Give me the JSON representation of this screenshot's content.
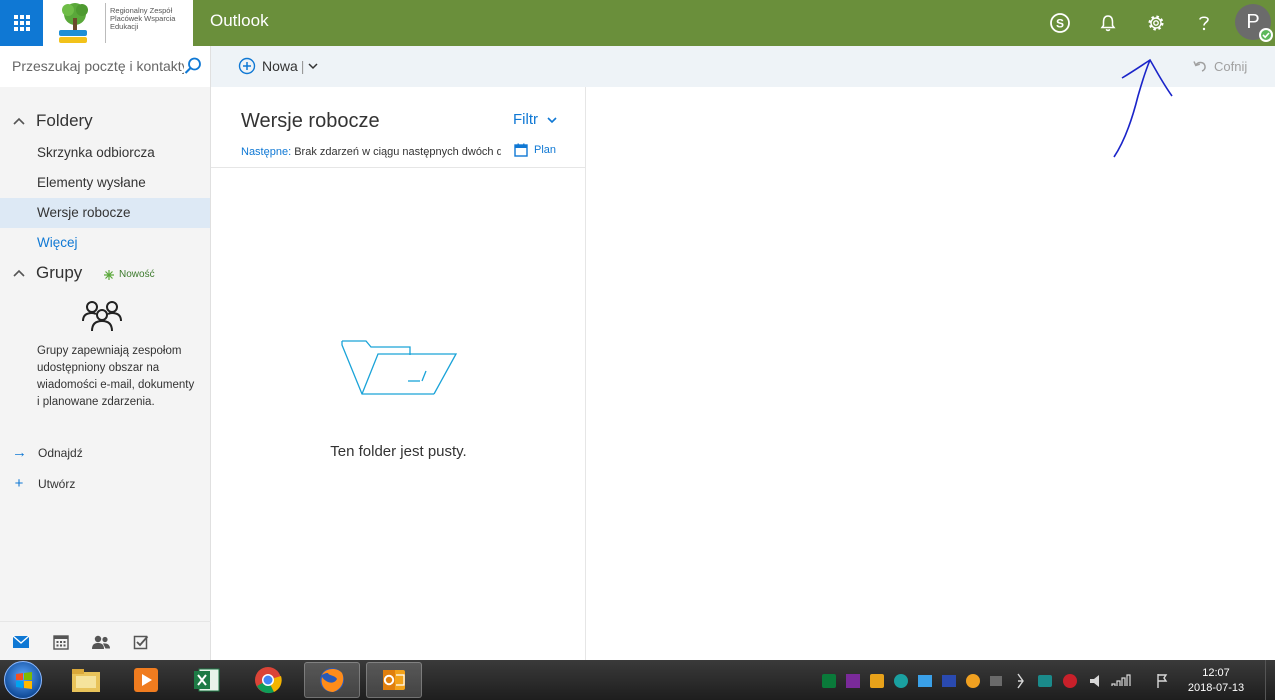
{
  "topbar": {
    "app_title": "Outlook",
    "org_name_lines": [
      "Regionalny Zespół",
      "Placówek Wsparcia",
      "Edukacji"
    ],
    "avatar_initial": "P",
    "accent": "#6a8f3b",
    "waffle_color": "#0f78d4"
  },
  "commandbar": {
    "search_placeholder": "Przeszukaj pocztę i kontakty",
    "new_label": "Nowa",
    "undo_label": "Cofnij"
  },
  "sidebar": {
    "folders_header": "Foldery",
    "folders": [
      {
        "label": "Skrzynka odbiorcza"
      },
      {
        "label": "Elementy wysłane"
      },
      {
        "label": "Wersje robocze",
        "selected": true
      }
    ],
    "more_label": "Więcej",
    "groups_header": "Grupy",
    "new_badge": "Nowość",
    "groups_description": "Grupy zapewniają zespołom udostępniony obszar na wiadomości e-mail, dokumenty i planowane zdarzenia.",
    "find_label": "Odnajdź",
    "create_label": "Utwórz"
  },
  "message_list": {
    "title": "Wersje robocze",
    "filter_label": "Filtr",
    "next_label": "Następne:",
    "next_text": "Brak zdarzeń w ciągu następnych dwóch dni",
    "plan_label": "Plan",
    "empty_text": "Ten folder jest pusty."
  },
  "taskbar": {
    "time": "12:07",
    "date": "2018-07-13"
  }
}
